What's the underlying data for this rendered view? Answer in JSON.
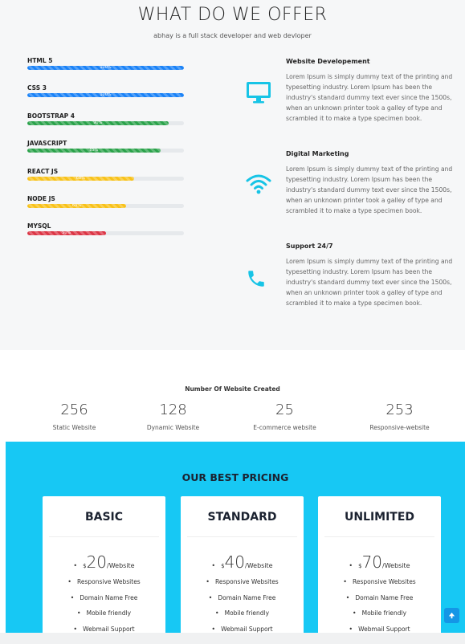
{
  "offer": {
    "title": "WHAT DO WE OFFER",
    "subtitle": "abhay is a full stack developer and web devloper",
    "skills": [
      {
        "name": "HTML 5",
        "label": "100%",
        "percent": 100,
        "color": "#1a82f7"
      },
      {
        "name": "CSS 3",
        "label": "100%",
        "percent": 100,
        "color": "#1a82f7"
      },
      {
        "name": "BOOTSTRAP 4",
        "label": "90%",
        "percent": 90,
        "color": "#2aa24a"
      },
      {
        "name": "JAVASCRIPT",
        "label": "85%",
        "percent": 85,
        "color": "#2aa24a"
      },
      {
        "name": "REACT JS",
        "label": "68%",
        "percent": 68,
        "color": "#f8c21a"
      },
      {
        "name": "NODE JS",
        "label": "63%",
        "percent": 63,
        "color": "#f8c21a"
      },
      {
        "name": "MYSQL",
        "label": "50%",
        "percent": 50,
        "color": "#dc3545"
      }
    ],
    "services": [
      {
        "icon": "monitor-icon",
        "title": "Website  Developement",
        "text": "Lorem Ipsum is simply dummy text of the printing and typesetting industry. Lorem Ipsum has been the industry's standard dummy text ever since the 1500s, when an unknown printer took a galley of type and scrambled it to make a type specimen book."
      },
      {
        "icon": "wifi-icon",
        "title": "Digital  Marketing",
        "text": "Lorem Ipsum is simply dummy text of the printing and typesetting industry. Lorem Ipsum has been the industry's standard dummy text ever since the 1500s, when an unknown printer took a galley of type and scrambled it to make a type specimen book."
      },
      {
        "icon": "phone-icon",
        "title": "Support  24/7",
        "text": "Lorem Ipsum is simply dummy text of the printing and typesetting industry. Lorem Ipsum has been the industry's standard dummy text ever since the 1500s, when an unknown printer took a galley of type and scrambled it to make a type specimen book."
      }
    ],
    "accent": "#17c4e6"
  },
  "stats": {
    "title": "Number Of Website Created",
    "items": [
      {
        "value": "256",
        "label": "Static Website"
      },
      {
        "value": "128",
        "label": "Dynamic Website"
      },
      {
        "value": "25",
        "label": "E-commerce website"
      },
      {
        "value": "253",
        "label": "Responsive-website"
      }
    ]
  },
  "pricing": {
    "title": "OUR BEST PRICING",
    "background": "#17c8f4",
    "plans": [
      {
        "name": "BASIC",
        "currency": "$",
        "amount": "20",
        "period": "/Website",
        "features": [
          "Responsive Websites",
          "Domain Name Free",
          "Mobile friendly",
          "Webmail Support"
        ]
      },
      {
        "name": "STANDARD",
        "currency": "$",
        "amount": "40",
        "period": "/Website",
        "features": [
          "Responsive Websites",
          "Domain Name Free",
          "Mobile friendly",
          "Webmail Support"
        ]
      },
      {
        "name": "UNLIMITED",
        "currency": "$",
        "amount": "70",
        "period": "/Website",
        "features": [
          "Responsive Websites",
          "Domain Name Free",
          "Mobile friendly",
          "Webmail Support"
        ]
      }
    ]
  },
  "scroll_top": {
    "icon": "arrow-up-icon"
  }
}
